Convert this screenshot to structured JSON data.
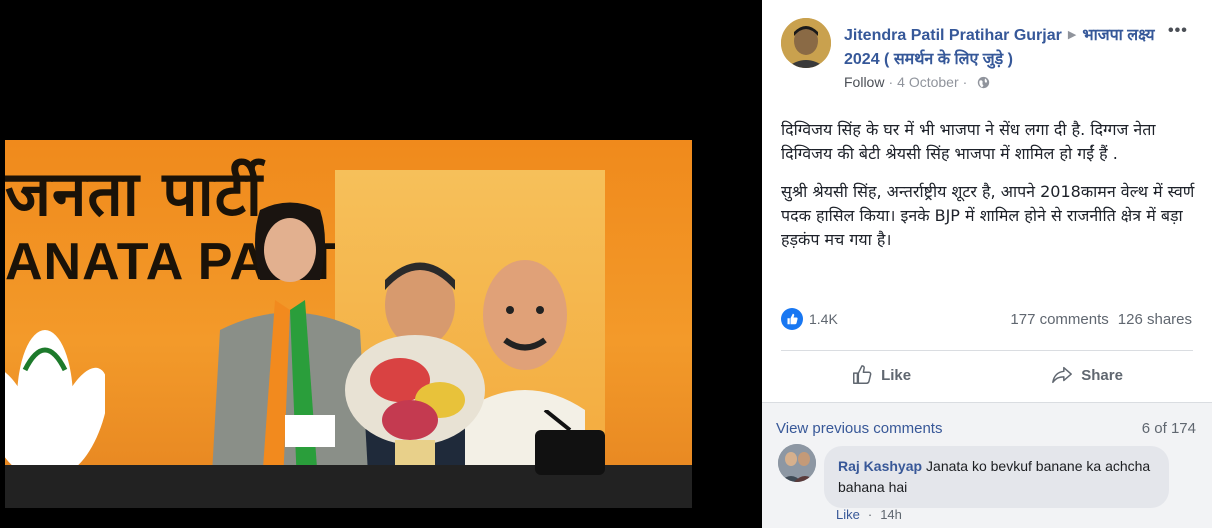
{
  "photo": {
    "banner_hindi": "जनता पार्टी",
    "banner_english": "ANATA PART"
  },
  "post": {
    "author": "Jitendra Patil Pratihar Gurjar",
    "group": "भाजपा लक्ष्य 2024 ( समर्थन के लिए जुड़े )",
    "more_icon": "•••",
    "follow": "Follow",
    "separator": "·",
    "date": "4 October",
    "privacy_icon": "globe-icon",
    "text_paragraph_1": "दिग्विजय सिंह के घर में भी भाजपा ने सेंध लगा दी है. दिग्गज नेता दिग्विजय की बेटी श्रेयसी सिंह भाजपा में शामिल हो गईं हैं .",
    "text_paragraph_2": "सुश्री श्रेयसी सिंह, अन्तर्राष्ट्रीय शूटर है, आपने 2018कामन वेल्थ में स्वर्ण पदक हासिल किया। इनके BJP में शामिल होने से राजनीति क्षेत्र में बड़ा हड़कंप मच गया है।",
    "reaction_count": "1.4K",
    "comments_count": "177 comments",
    "shares_count": "126 shares",
    "like_label": "Like",
    "share_label": "Share"
  },
  "comments": {
    "view_previous": "View previous comments",
    "position": "6 of 174",
    "items": [
      {
        "author": "Raj Kashyap",
        "text": "Janata ko bevkuf banane ka achcha bahana hai",
        "like_label": "Like",
        "time": "14h"
      }
    ]
  },
  "colors": {
    "link_blue": "#365899",
    "like_blue": "#1877f2",
    "muted": "#606770",
    "comment_bg": "#f2f3f5"
  }
}
